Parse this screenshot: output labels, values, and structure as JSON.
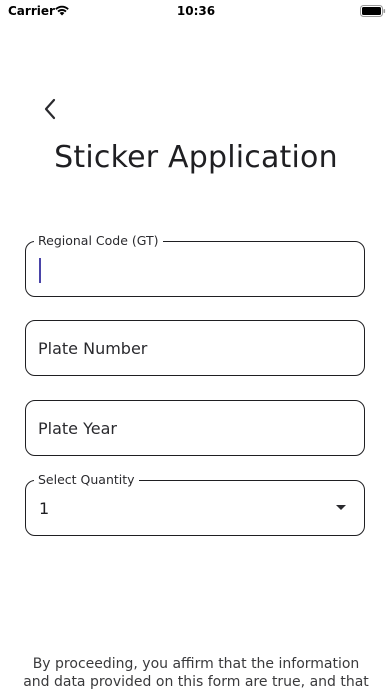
{
  "status_bar": {
    "carrier": "Carrier",
    "time": "10:36"
  },
  "header": {
    "title": "Sticker Application"
  },
  "form": {
    "regional_code": {
      "label": "Regional Code (GT)",
      "value": ""
    },
    "plate_number": {
      "placeholder": "Plate Number",
      "value": ""
    },
    "plate_year": {
      "placeholder": "Plate Year",
      "value": ""
    },
    "quantity": {
      "label": "Select Quantity",
      "selected": "1"
    }
  },
  "footer": {
    "disclaimer": "By proceeding, you affirm that the information and data provided on this form are true, and that"
  },
  "colors": {
    "text": "#1f1f22",
    "border": "#1f1f22",
    "cursor": "#4a44a8",
    "background": "#ffffff"
  },
  "icons": [
    "wifi-icon",
    "battery-icon",
    "back-chevron-icon",
    "dropdown-caret-icon"
  ]
}
